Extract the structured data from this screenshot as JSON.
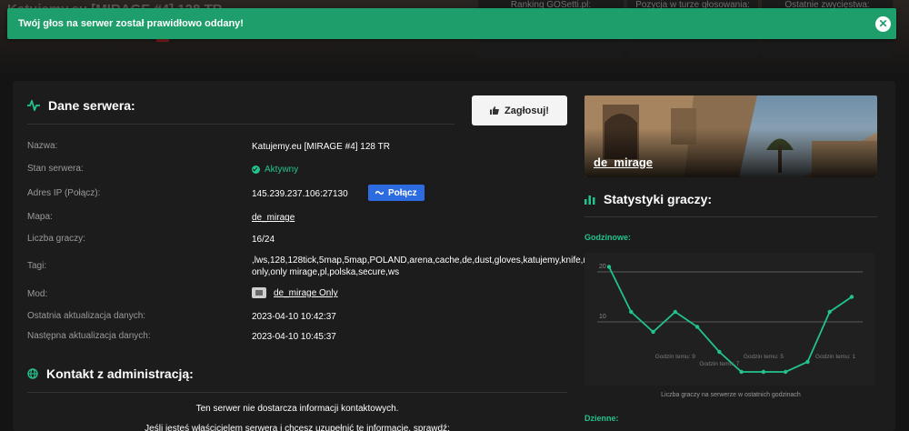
{
  "hero": {
    "title": "Katujemy.eu [MIRAGE #4] 128 TR",
    "cards": [
      "Ranking GOSetti.pl:",
      "Pozycja w turze głosowania:",
      "Ostatnie zwycięstwa:"
    ]
  },
  "toast": {
    "message": "Twój głos na serwer został prawidłowo oddany!",
    "close_icon": "close-icon"
  },
  "server": {
    "heading": "Dane serwera:",
    "heading_icon": "pulse-icon",
    "vote_label": "Zagłosuj!",
    "vote_icon": "thumbs-up-icon",
    "rows": {
      "name": {
        "label": "Nazwa:",
        "value": "Katujemy.eu [MIRAGE #4] 128 TR"
      },
      "state": {
        "label": "Stan serwera:",
        "value": "Aktywny"
      },
      "ip": {
        "label": "Adres IP (Połącz):",
        "value": "145.239.237.106:27130",
        "connect_label": "Połącz"
      },
      "map": {
        "label": "Mapa:",
        "value": "de_mirage"
      },
      "players": {
        "label": "Liczba graczy:",
        "value": "16/24"
      },
      "tags": {
        "label": "Tagi:",
        "value": ",lws,128,128tick,5map,5map,POLAND,arena,cache,de,dust,gloves,katujemy,knife,mirage,mirage only,only mirage,pl,polska,secure,ws"
      },
      "mod": {
        "label": "Mod:",
        "value": "de_mirage Only"
      },
      "last_update": {
        "label": "Ostatnia aktualizacja danych:",
        "value": "2023-04-10 10:42:37"
      },
      "next_update": {
        "label": "Następna aktualizacja danych:",
        "value": "2023-04-10 10:45:37"
      }
    }
  },
  "contact": {
    "heading": "Kontakt z administracją:",
    "heading_icon": "globe-icon",
    "line1": "Ten serwer nie dostarcza informacji kontaktowych.",
    "line2": "Jeśli jesteś właścicielem serwera i chcesz uzupełnić te informacje, sprawdź:"
  },
  "map_card": {
    "name": "de_mirage"
  },
  "stats": {
    "heading": "Statystyki graczy:",
    "heading_icon": "bar-chart-icon",
    "hourly_label": "Godzinowe:",
    "daily_label": "Dzienne:"
  },
  "colors": {
    "accent": "#22c38e",
    "toast": "#1e9e6a",
    "connect": "#2d6be0"
  },
  "chart_data": {
    "type": "line",
    "ylim": [
      0,
      22
    ],
    "y_ticks": [
      10,
      20
    ],
    "values": [
      21,
      12,
      8,
      12,
      9,
      4,
      0,
      0,
      0,
      2,
      12,
      15
    ],
    "annotations": [
      "Godzin temu: 9",
      "Godzin temu: 7",
      "Godzin temu: 5",
      "Godzin temu: 1"
    ],
    "caption": "Liczba graczy na serwerze w ostatnich godzinach",
    "grid": true
  }
}
